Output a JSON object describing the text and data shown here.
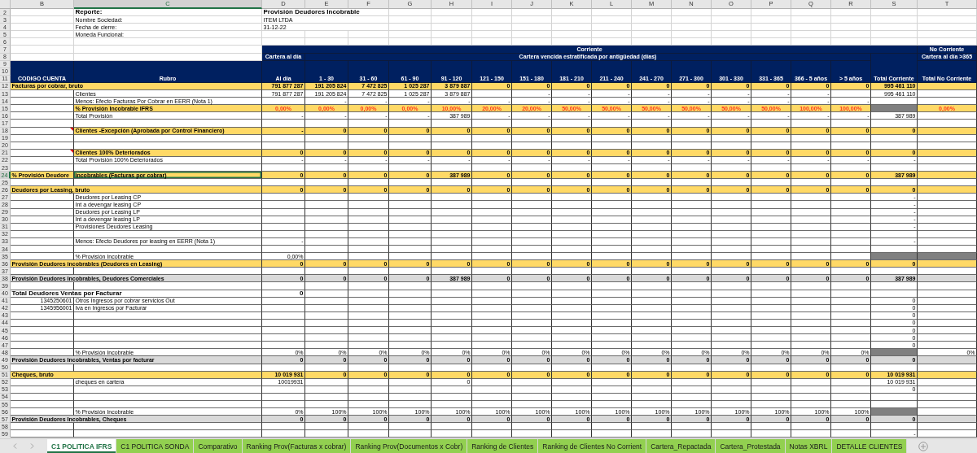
{
  "columns": [
    {
      "letter": "B",
      "selected": false
    },
    {
      "letter": "C",
      "selected": true
    },
    {
      "letter": "D",
      "selected": false
    },
    {
      "letter": "E",
      "selected": false
    },
    {
      "letter": "F",
      "selected": false
    },
    {
      "letter": "G",
      "selected": false
    },
    {
      "letter": "H",
      "selected": false
    },
    {
      "letter": "I",
      "selected": false
    },
    {
      "letter": "J",
      "selected": false
    },
    {
      "letter": "K",
      "selected": false
    },
    {
      "letter": "L",
      "selected": false
    },
    {
      "letter": "M",
      "selected": false
    },
    {
      "letter": "N",
      "selected": false
    },
    {
      "letter": "O",
      "selected": false
    },
    {
      "letter": "P",
      "selected": false
    },
    {
      "letter": "Q",
      "selected": false
    },
    {
      "letter": "R",
      "selected": false
    },
    {
      "letter": "S",
      "selected": false
    },
    {
      "letter": "T",
      "selected": false
    }
  ],
  "top_rows": [
    {
      "num": "2",
      "kind": "title",
      "cells": [
        null,
        "Reporte:",
        "Provisión Deudores Incobrable"
      ]
    },
    {
      "num": "3",
      "kind": "info",
      "cells": [
        null,
        "Nombre Sociedad:",
        "ITEM LTDA"
      ]
    },
    {
      "num": "4",
      "kind": "info",
      "cells": [
        null,
        "Fecha de cierre:",
        "31-12-22"
      ]
    },
    {
      "num": "5",
      "kind": "info",
      "cells": [
        null,
        "Moneda Funcional:"
      ]
    },
    {
      "num": "6",
      "kind": "info"
    }
  ],
  "header": {
    "row_numbers": [
      "7",
      "8",
      "9",
      "10",
      "11"
    ],
    "group_current": "Corriente",
    "group_non_current": "No Corriente",
    "subgroup_on_time": "Cartera al día",
    "subgroup_overdue": "Cartera vencida estratificada por antigüedad (días)",
    "subgroup_non_current": "Cartera al día >365",
    "labels": [
      "CODIGO CUENTA",
      "Rubro",
      "Al día",
      "1 - 30",
      "31 - 60",
      "61 - 90",
      "91 - 120",
      "121 - 150",
      "151 - 180",
      "181 - 210",
      "211 - 240",
      "241 - 270",
      "271 - 300",
      "301 - 330",
      "331 - 365",
      "366 - 5 años",
      "> 5 años",
      "Total Corriente",
      "Total No Corriente"
    ]
  },
  "rows": [
    {
      "num": "12",
      "kind": "total",
      "cells": [
        "Facturas por cobrar, bruto",
        null,
        "791 877 287",
        "191 205 824",
        "7 472 825",
        "1 025 287",
        "3 879 887",
        "0",
        "0",
        "0",
        "0",
        "0",
        "0",
        "0",
        "0",
        "0",
        "0",
        "995 461 110"
      ]
    },
    {
      "num": "13",
      "kind": "plain",
      "cells": [
        null,
        "Clientes",
        "791 877 287",
        "191 205 824",
        "7 472 825",
        "1 025 287",
        "3 879 887",
        null,
        "-",
        "-",
        "-",
        "-",
        "-",
        "-",
        "-",
        "-",
        null,
        "995 461 110"
      ]
    },
    {
      "num": "14",
      "kind": "plain",
      "cells": [
        null,
        "Menos: Efecto Facturas Por Cobrar en EERR (Nota 1)",
        null,
        "-",
        "-",
        "-",
        "-",
        "-",
        "-",
        "-",
        "-",
        "-",
        "-",
        "-",
        "-",
        "-",
        "-"
      ]
    },
    {
      "num": "15",
      "kind": "rate",
      "cells": [
        null,
        "% Provisión Incobrable IFRS",
        "0,00%",
        "0,00%",
        "0,00%",
        "0,00%",
        "10,00%",
        "20,00%",
        "20,00%",
        "50,00%",
        "50,00%",
        "50,00%",
        "50,00%",
        "50,00%",
        "50,00%",
        "100,00%",
        "100,00%",
        {
          "color": "#808080"
        },
        "0,00%"
      ]
    },
    {
      "num": "16",
      "kind": "plain",
      "cells": [
        null,
        "Total Provisión",
        "-",
        "-",
        "-",
        "-",
        "387 989",
        "-",
        "-",
        "-",
        "-",
        "-",
        "-",
        "-",
        "-",
        "-",
        "-",
        "387 989"
      ]
    },
    {
      "num": "17",
      "kind": "plain"
    },
    {
      "num": "18",
      "kind": "total-c",
      "cells": [
        {
          "comment": true
        },
        "Clientes -Excepción (Aprobada por Control Financiero)",
        "-",
        "0",
        "0",
        "0",
        "0",
        "0",
        "0",
        "0",
        "0",
        "0",
        "0",
        "0",
        "0",
        "0",
        "0",
        "0"
      ]
    },
    {
      "num": "19",
      "kind": "plain"
    },
    {
      "num": "20",
      "kind": "plain"
    },
    {
      "num": "21",
      "kind": "total-c",
      "cells": [
        {
          "comment": true
        },
        "Clientes 100% Deteriorados",
        "0",
        "0",
        "0",
        "0",
        "0",
        "0",
        "0",
        "0",
        "0",
        "0",
        "0",
        "0",
        "0",
        "0",
        "0",
        "0"
      ]
    },
    {
      "num": "22",
      "kind": "plain",
      "cells": [
        null,
        "Total Provisión 100% Deteriorados",
        "-",
        "-",
        "-",
        "-",
        "-",
        "-",
        "-",
        "-",
        "-",
        "-",
        "-",
        "-",
        "-",
        "-",
        "-",
        "-"
      ]
    },
    {
      "num": "23",
      "kind": "plain"
    },
    {
      "num": "24",
      "kind": "total",
      "cells": [
        "% Provisión Deudore",
        {
          "text": "incobrables (Facturas por cobrar)",
          "selected": true
        },
        "0",
        "0",
        "0",
        "0",
        "387 989",
        "0",
        "0",
        "0",
        "0",
        "0",
        "0",
        "0",
        "0",
        "0",
        "0",
        "387 989"
      ]
    },
    {
      "num": "25",
      "kind": "plain"
    },
    {
      "num": "26",
      "kind": "total",
      "cells": [
        "Deudores por Leasing, bruto",
        null,
        "0",
        "0",
        "0",
        "0",
        "0",
        "0",
        "0",
        "0",
        "0",
        "0",
        "0",
        "0",
        "0",
        "0",
        "0",
        "0"
      ]
    },
    {
      "num": "27",
      "kind": "plain",
      "cells": [
        null,
        "Deudores por Leasing CP",
        null,
        null,
        null,
        null,
        null,
        null,
        null,
        null,
        null,
        null,
        null,
        null,
        null,
        null,
        null,
        "-"
      ]
    },
    {
      "num": "28",
      "kind": "plain",
      "cells": [
        null,
        "Int a devengar leasing CP",
        null,
        null,
        null,
        null,
        null,
        null,
        null,
        null,
        null,
        null,
        null,
        null,
        null,
        null,
        null,
        "-"
      ]
    },
    {
      "num": "29",
      "kind": "plain",
      "cells": [
        null,
        "Deudores por Leasing LP",
        null,
        null,
        null,
        null,
        null,
        null,
        null,
        null,
        null,
        null,
        null,
        null,
        null,
        null,
        null,
        "-"
      ]
    },
    {
      "num": "30",
      "kind": "plain",
      "cells": [
        null,
        "Int a devengar leasing LP",
        null,
        null,
        null,
        null,
        null,
        null,
        null,
        null,
        null,
        null,
        null,
        null,
        null,
        null,
        null,
        "-"
      ]
    },
    {
      "num": "31",
      "kind": "plain",
      "cells": [
        null,
        "Provisiones Deudores Leasing",
        null,
        null,
        null,
        null,
        null,
        null,
        null,
        null,
        null,
        null,
        null,
        null,
        null,
        null,
        null,
        "-"
      ]
    },
    {
      "num": "32",
      "kind": "plain"
    },
    {
      "num": "33",
      "kind": "plain",
      "cells": [
        null,
        "Menos: Efecto Deudores por leasing en EERR (Nota 1)",
        "-",
        null,
        null,
        null,
        null,
        null,
        null,
        null,
        null,
        null,
        null,
        null,
        null,
        null,
        null,
        "-"
      ]
    },
    {
      "num": "34",
      "kind": "plain"
    },
    {
      "num": "35",
      "kind": "plain",
      "cells": [
        null,
        "% Provisión Incobrable",
        "0,00%",
        null,
        null,
        null,
        null,
        null,
        null,
        null,
        null,
        null,
        null,
        null,
        null,
        null,
        null,
        {
          "color": "#808080"
        },
        {
          "color": "#808080"
        }
      ]
    },
    {
      "num": "36",
      "kind": "total",
      "cells": [
        "Provisión Deudores incobrables (Deudores en Leasing)",
        null,
        "0",
        "0",
        "0",
        "0",
        "0",
        "0",
        "0",
        "0",
        "0",
        "0",
        "0",
        "0",
        "0",
        "0",
        "0",
        "0"
      ]
    },
    {
      "num": "37",
      "kind": "plain"
    },
    {
      "num": "38",
      "kind": "gray",
      "cells": [
        "Provisión Deudores incobrables, Deudores Comerciales",
        null,
        "0",
        "0",
        "0",
        "0",
        "387 989",
        "0",
        "0",
        "0",
        "0",
        "0",
        "0",
        "0",
        "0",
        "0",
        "0",
        "387 989"
      ]
    },
    {
      "num": "39",
      "kind": "plain"
    },
    {
      "num": "40",
      "kind": "heading",
      "cells": [
        "Total Deudores Ventas por Facturar",
        null,
        "0"
      ]
    },
    {
      "num": "41",
      "kind": "code",
      "cells": [
        "1345250601",
        "Otros Ingresos por cobrar servicios Out",
        null,
        null,
        null,
        null,
        null,
        null,
        null,
        null,
        null,
        null,
        null,
        null,
        null,
        null,
        null,
        "0"
      ]
    },
    {
      "num": "42",
      "kind": "code",
      "cells": [
        "1345956001",
        "Iva en Ingresos por Facturar",
        null,
        null,
        null,
        null,
        null,
        null,
        null,
        null,
        null,
        null,
        null,
        null,
        null,
        null,
        null,
        "0"
      ]
    },
    {
      "num": "43",
      "kind": "plain",
      "cells": [
        null,
        null,
        null,
        null,
        null,
        null,
        null,
        null,
        null,
        null,
        null,
        null,
        null,
        null,
        null,
        null,
        null,
        "0"
      ]
    },
    {
      "num": "44",
      "kind": "plain",
      "cells": [
        null,
        null,
        null,
        null,
        null,
        null,
        null,
        null,
        null,
        null,
        null,
        null,
        null,
        null,
        null,
        null,
        null,
        "0"
      ]
    },
    {
      "num": "45",
      "kind": "plain",
      "cells": [
        null,
        null,
        null,
        null,
        null,
        null,
        null,
        null,
        null,
        null,
        null,
        null,
        null,
        null,
        null,
        null,
        null,
        "0"
      ]
    },
    {
      "num": "46",
      "kind": "plain",
      "cells": [
        null,
        null,
        null,
        null,
        null,
        null,
        null,
        null,
        null,
        null,
        null,
        null,
        null,
        null,
        null,
        null,
        null,
        "0"
      ]
    },
    {
      "num": "47",
      "kind": "plain",
      "cells": [
        null,
        null,
        null,
        null,
        null,
        null,
        null,
        null,
        null,
        null,
        null,
        null,
        null,
        null,
        null,
        null,
        null,
        "0"
      ]
    },
    {
      "num": "48",
      "kind": "plain",
      "cells": [
        null,
        "% Provisión Incobrable",
        "0%",
        "0%",
        "0%",
        "0%",
        "0%",
        "0%",
        "0%",
        "0%",
        "0%",
        "0%",
        "0%",
        "0%",
        "0%",
        "0%",
        "0%",
        {
          "color": "#808080"
        },
        "0%"
      ]
    },
    {
      "num": "49",
      "kind": "gray",
      "cells": [
        "Provisión Deudores Incobrables, Ventas por facturar",
        null,
        "0",
        "0",
        "0",
        "0",
        "0",
        "0",
        "0",
        "0",
        "0",
        "0",
        "0",
        "0",
        "0",
        "0",
        "0",
        "0"
      ]
    },
    {
      "num": "50",
      "kind": "plain"
    },
    {
      "num": "51",
      "kind": "total",
      "cells": [
        "Cheques, bruto",
        null,
        "10 019 931",
        "0",
        "0",
        "0",
        "0",
        "0",
        "0",
        "0",
        "0",
        "0",
        "0",
        "0",
        "0",
        "0",
        "0",
        "10 019 931"
      ]
    },
    {
      "num": "52",
      "kind": "plain",
      "cells": [
        null,
        "cheques en cartera",
        "10019931",
        null,
        null,
        null,
        "0",
        null,
        null,
        null,
        null,
        null,
        null,
        null,
        null,
        null,
        null,
        "10 019 931"
      ]
    },
    {
      "num": "53",
      "kind": "plain",
      "cells": [
        null,
        null,
        null,
        null,
        null,
        null,
        null,
        null,
        null,
        null,
        null,
        null,
        null,
        null,
        null,
        null,
        null,
        "0"
      ]
    },
    {
      "num": "54",
      "kind": "plain"
    },
    {
      "num": "55",
      "kind": "plain"
    },
    {
      "num": "56",
      "kind": "plain",
      "cells": [
        null,
        "% Provisión Incobrable",
        "0%",
        "100%",
        "100%",
        "100%",
        "100%",
        "100%",
        "100%",
        "100%",
        "100%",
        "100%",
        "100%",
        "100%",
        "100%",
        "100%",
        "100%",
        {
          "color": "#808080"
        }
      ]
    },
    {
      "num": "57",
      "kind": "gray",
      "cells": [
        "Provisión Deudores Incobrables, Cheques",
        null,
        "0",
        "0",
        "0",
        "0",
        "0",
        "0",
        "0",
        "0",
        "0",
        "0",
        "0",
        "0",
        "0",
        "0",
        "0",
        "0"
      ]
    },
    {
      "num": "58",
      "kind": "plain"
    },
    {
      "num": "59",
      "kind": "plain",
      "cells": [
        null,
        null,
        null,
        null,
        null,
        null,
        null,
        null,
        null,
        null,
        null,
        null,
        null,
        null,
        null,
        null,
        null,
        "-"
      ]
    }
  ],
  "tabs": [
    {
      "label": "C1 POLITICA IFRS",
      "selected": true
    },
    {
      "label": "C1 POLITICA SONDA",
      "selected": false
    },
    {
      "label": "Comparativo",
      "selected": false
    },
    {
      "label": "Ranking Prov(Facturas x cobrar)",
      "selected": false
    },
    {
      "label": "Ranking Prov(Documentos x Cobr)",
      "selected": false
    },
    {
      "label": "Ranking de Clientes",
      "selected": false
    },
    {
      "label": "Ranking de Clientes No Corrient",
      "selected": false
    },
    {
      "label": "Cartera_Repactada",
      "selected": false
    },
    {
      "label": "Cartera_Protestada",
      "selected": false
    },
    {
      "label": "Notas XBRL",
      "selected": false
    },
    {
      "label": "DETALLE CLIENTES",
      "selected": false
    }
  ]
}
